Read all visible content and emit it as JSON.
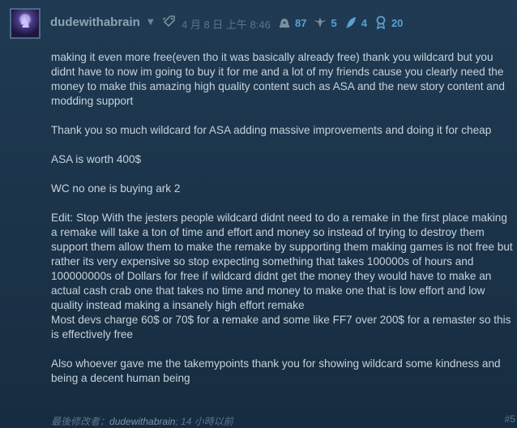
{
  "post": {
    "author": {
      "name": "dudewithabrain",
      "avatar_icon": "purple-character-avatar",
      "dropdown_icon": "caret-down"
    },
    "timestamp": "4 月 8 日 上午 8:46",
    "stats": [
      {
        "icon": "xp-helmet-icon",
        "value": "87"
      },
      {
        "icon": "winged-badge-icon",
        "value": "5"
      },
      {
        "icon": "feather-icon",
        "value": "4"
      },
      {
        "icon": "medal-icon",
        "value": "20"
      }
    ],
    "paragraphs": [
      "making it even more free(even tho it was basically already free) thank you wildcard but you didnt have to now im going to buy it for me and a lot of my friends cause you clearly need the money to make this amazing high quality content such as ASA and the new story content and modding support",
      "Thank you so much wildcard for ASA adding massive improvements and doing it for cheap",
      "ASA is worth 400$",
      "WC no one is buying ark 2",
      "Edit: Stop With the jesters people wildcard didnt need to do a remake in the first place making a remake will take a ton of time and effort and money so instead of trying to destroy them support them allow them to make the remake by supporting them making games is not free but rather its very expensive so stop expecting something that takes 100000s of hours and 100000000s of Dollars for free if wildcard didnt get the money they would have to make an actual cash crab one that takes no time and money to make one that is low effort and low quality instead making a insanely high effort remake\nMost devs charge 60$ or 70$ for a remake and some like FF7 over 200$ for a remaster so this is effectively free",
      "Also whoever gave me the takemypoints thank you for showing wildcard some kindness and being a decent human being"
    ],
    "edit_note": {
      "prefix": "最後修改者：",
      "editor": "dudewithabrain",
      "suffix": "; 14 小時以前"
    },
    "post_number": "#5"
  },
  "colors": {
    "accent": "#5aa0d3",
    "text": "#c7d2db",
    "muted": "#5f7588"
  }
}
